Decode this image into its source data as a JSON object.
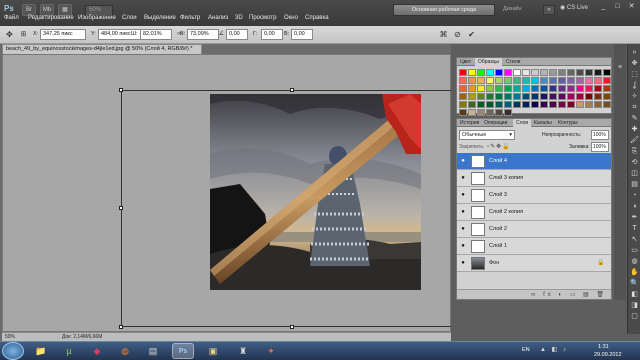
{
  "app": {
    "logo": "Ps",
    "menu": [
      "Файл",
      "Редактирование",
      "Изображение",
      "Слои",
      "Выделение",
      "Фильтр",
      "Анализ",
      "3D",
      "Просмотр",
      "Окно",
      "Справка"
    ],
    "zoom": "50%",
    "workspace_button": "Основная рабочая среда",
    "design_link": "Дизайн",
    "cs_live": "CS Live",
    "window_controls": [
      "_",
      "□",
      "✕"
    ]
  },
  "options": {
    "x_label": "X:",
    "x_value": "347,25 пикс",
    "y_label": "Y:",
    "y_value": "484,00 пикс",
    "w_label": "Ш:",
    "w_value": "82,01%",
    "h_label": "В:",
    "h_value": "73,09%",
    "angle_value": "0,00",
    "hskew_label": "Г:",
    "hskew_value": "0,00",
    "vskew_label": "В:",
    "vskew_value": "0,00",
    "icons": [
      "move-icon",
      "reference-point-icon",
      "link-icon",
      "angle-icon",
      "warp-icon",
      "cancel-icon",
      "commit-icon"
    ]
  },
  "document": {
    "tab_title": "beach_49_by_equinoxstockimages-d4jie1ed.jpg @ 50% (Слой 4, RGB/8#) *",
    "status_zoom": "50%",
    "status_info": "Док: 2,14M/6,66M"
  },
  "swatches": {
    "tabs": [
      "Цвет",
      "Образцы",
      "Стили"
    ],
    "active_tab": 1,
    "colors": [
      "#ff0000",
      "#ffff00",
      "#00ff00",
      "#00ffff",
      "#0000ff",
      "#ff00ff",
      "#ffffff",
      "#e6e6e6",
      "#cccccc",
      "#b3b3b3",
      "#999999",
      "#808080",
      "#666666",
      "#4d4d4d",
      "#333333",
      "#1a1a1a",
      "#000000",
      "#f26c4f",
      "#f68e56",
      "#fbaf5d",
      "#fff467",
      "#acd372",
      "#7cc576",
      "#3bb878",
      "#1abbb4",
      "#00bff3",
      "#438ccb",
      "#5574b9",
      "#605ca8",
      "#855fa8",
      "#a763a8",
      "#f06ea9",
      "#f26d7d",
      "#ed1c24",
      "#f26522",
      "#f7941d",
      "#fff200",
      "#8dc63f",
      "#39b54a",
      "#00a651",
      "#00a99d",
      "#00aeef",
      "#0072bc",
      "#0054a6",
      "#2e3192",
      "#662d91",
      "#92278f",
      "#ec008c",
      "#ed145b",
      "#9e0b0f",
      "#a0410d",
      "#a36209",
      "#aba000",
      "#598527",
      "#1a7b30",
      "#007236",
      "#00746b",
      "#0076a3",
      "#004b80",
      "#003471",
      "#1b1464",
      "#440e62",
      "#630460",
      "#9e005d",
      "#9e0039",
      "#790000",
      "#7b2e00",
      "#7d4900",
      "#827b00",
      "#406618",
      "#005e20",
      "#005826",
      "#005952",
      "#005b7f",
      "#003663",
      "#002157",
      "#0d004c",
      "#32004b",
      "#4b0049",
      "#7b0046",
      "#7a0026",
      "#c69c6d",
      "#a67c52",
      "#8c6239",
      "#754c24",
      "#603913",
      "#c7b299",
      "#998675",
      "#736357",
      "#534741",
      "#362f2d"
    ]
  },
  "layers": {
    "tabs": [
      "История",
      "Операции",
      "Слои",
      "Каналы",
      "Контуры"
    ],
    "active_tab": 2,
    "blend_mode": "Обычные",
    "opacity_label": "Непрозрачность:",
    "opacity_value": "100%",
    "fill_label": "Заливка:",
    "fill_value": "100%",
    "lock_label": "Закрепить:",
    "items": [
      {
        "name": "Слой 4",
        "selected": true
      },
      {
        "name": "Слой 3 копия",
        "selected": false
      },
      {
        "name": "Слой 3",
        "selected": false
      },
      {
        "name": "Слой 2 копия",
        "selected": false
      },
      {
        "name": "Слой 2",
        "selected": false
      },
      {
        "name": "Слой 1",
        "selected": false
      },
      {
        "name": "Фон",
        "selected": false
      }
    ]
  },
  "taskbar": {
    "time": "1:31",
    "date": "29.09.2012",
    "language": "EN"
  }
}
